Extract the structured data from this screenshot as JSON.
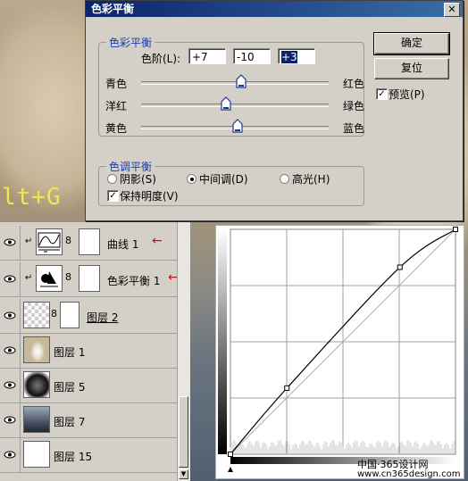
{
  "dialog": {
    "title": "色彩平衡",
    "close_glyph": "✕",
    "balance_group_label": "色彩平衡",
    "levels_label": "色阶(L):",
    "levels": [
      "+7",
      "-10",
      "+3"
    ],
    "sliders": [
      {
        "left": "青色",
        "right": "红色",
        "value": 7
      },
      {
        "left": "洋红",
        "right": "绿色",
        "value": -10
      },
      {
        "left": "黄色",
        "right": "蓝色",
        "value": 3
      }
    ],
    "tone_group_label": "色调平衡",
    "tones": [
      {
        "label": "阴影(S)",
        "selected": false
      },
      {
        "label": "中间调(D)",
        "selected": true
      },
      {
        "label": "高光(H)",
        "selected": false
      }
    ],
    "preserve_luminosity_label": "保持明度(V)",
    "preserve_luminosity_checked": true,
    "ok_label": "确定",
    "reset_label": "复位",
    "preview_label": "预览(P)",
    "preview_checked": true
  },
  "shortcut_hint": "lt+G",
  "layers": [
    {
      "name": "曲线 1",
      "thumb": "curves-icon",
      "adjustment": true,
      "marked": true
    },
    {
      "name": "色彩平衡 1",
      "thumb": "color-balance-icon",
      "adjustment": true,
      "marked": true
    },
    {
      "name": "图层 2",
      "thumb": "transparent",
      "adjustment": false,
      "marked": false
    },
    {
      "name": "图层 1",
      "thumb": "figure",
      "adjustment": false,
      "marked": false
    },
    {
      "name": "图层 5",
      "thumb": "dark-sphere",
      "adjustment": false,
      "marked": false
    },
    {
      "name": "图层 7",
      "thumb": "sky",
      "adjustment": false,
      "marked": false
    },
    {
      "name": "图层 15",
      "thumb": "white",
      "adjustment": false,
      "marked": false
    }
  ],
  "curves": {
    "points": [
      [
        0,
        0
      ],
      [
        64,
        75
      ],
      [
        192,
        212
      ],
      [
        255,
        255
      ]
    ]
  },
  "credits": {
    "line1": "中国·365设计网",
    "line2": "www.cn365design.com"
  },
  "colors": {
    "title_bar": "#0a246a",
    "group_label": "#1a3ca8",
    "marker_arrow": "#d01010",
    "hint_text": "#f0e74a"
  }
}
